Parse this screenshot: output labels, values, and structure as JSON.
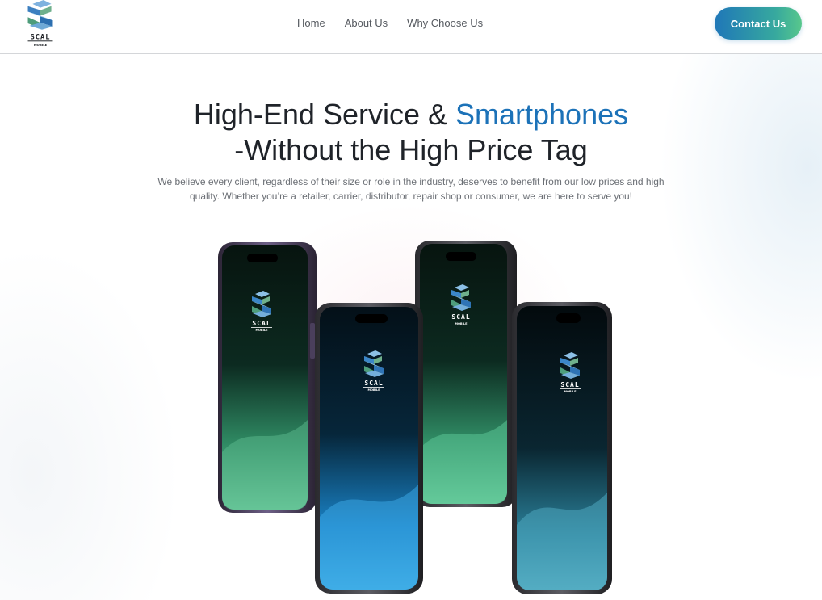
{
  "brand": {
    "logo_text": "SCAL",
    "logo_subtext": "MOBILE",
    "logo_colors": [
      "#2f7fc1",
      "#5aa7d8",
      "#3e8f7a",
      "#8cc7a0"
    ]
  },
  "nav": {
    "items": [
      {
        "label": "Home"
      },
      {
        "label": "About Us"
      },
      {
        "label": "Why Choose Us"
      }
    ]
  },
  "header": {
    "cta_label": "Contact Us"
  },
  "hero": {
    "title_part1": "High-End Service & ",
    "title_accent": "Smartphones",
    "title_line2": "-Without the High Price Tag",
    "description": "We believe every client, regardless of their size or role in the industry, deserves to benefit from our low prices and high quality. Whether you’re a retailer, carrier, distributor, repair shop or consumer, we are here to serve you!"
  },
  "phones": {
    "count": 4,
    "screen_themes": [
      "green",
      "blue",
      "green",
      "teal"
    ],
    "screen_logo_text": "SCAL",
    "screen_logo_subtext": "MOBILE"
  },
  "colors": {
    "accent": "#1c72b8",
    "cta_start": "#1f77b8",
    "cta_end": "#58c78c",
    "heading": "#1f2329",
    "body_text": "#6b6f75"
  }
}
